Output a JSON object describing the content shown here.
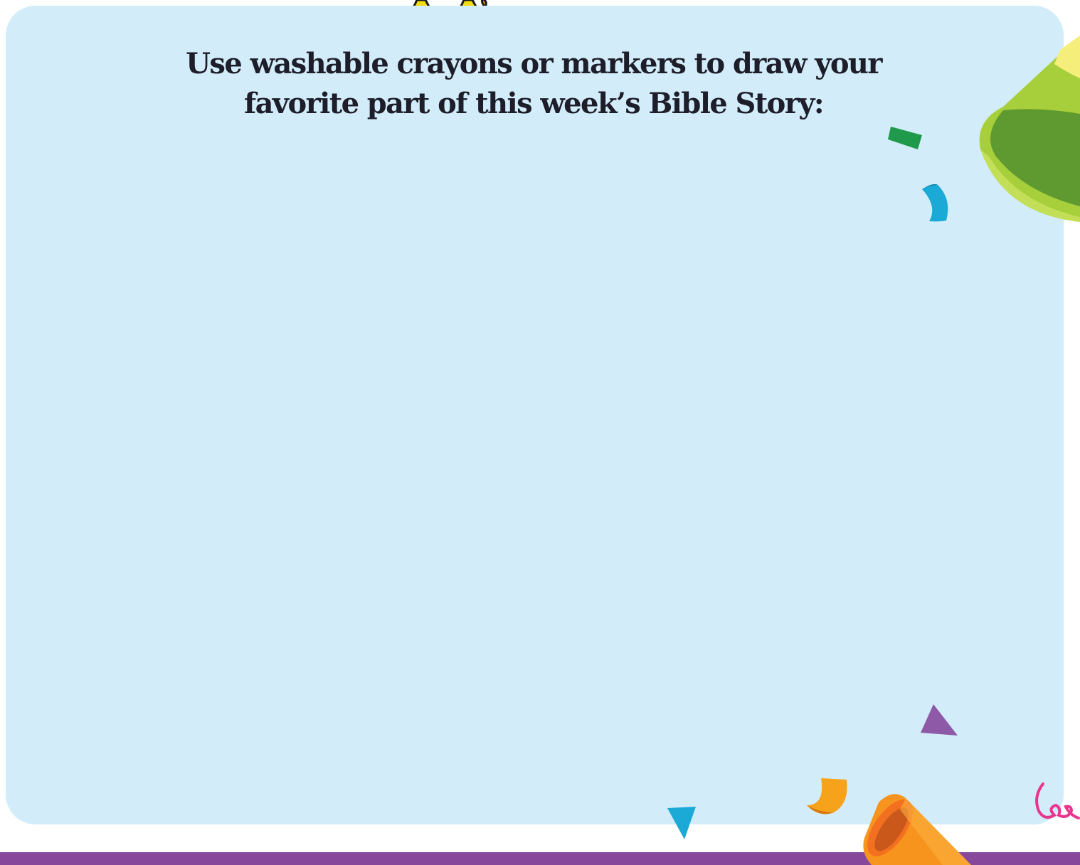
{
  "activity": {
    "instruction_line_1": "Use washable crayons or markers to draw your",
    "instruction_line_2": "favorite part of this week’s Bible Story:"
  },
  "decorations": {
    "icons": [
      "chick-feet-icon",
      "party-hat-icon",
      "party-horn-icon",
      "confetti-icon",
      "streamer-swirl-icon"
    ]
  },
  "colors": {
    "drawing_area": "#d2edf9",
    "bottom_bar": "#87489b",
    "text": "#1e1e2a",
    "party_hat_green": "#8cc63f",
    "party_horn_orange": "#f7941d",
    "confetti_blue": "#1ba9d6",
    "confetti_green": "#1f9a4a",
    "confetti_purple": "#8e5aa8",
    "confetti_orange": "#f7a21b",
    "streamer_pink": "#e8368f"
  }
}
